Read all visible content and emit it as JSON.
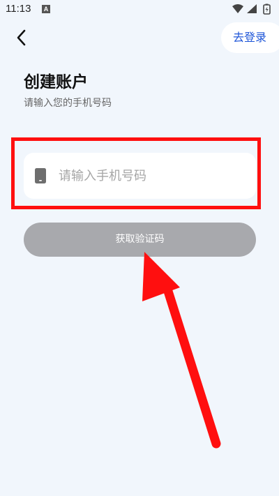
{
  "status_bar": {
    "time": "11:13",
    "notification_letter": "A",
    "icons": [
      "wifi-icon",
      "signal-icon",
      "battery-icon"
    ]
  },
  "header": {
    "back_icon": "chevron-left-icon",
    "login_label": "去登录"
  },
  "main": {
    "title": "创建账户",
    "subtitle": "请输入您的手机号码",
    "phone_input": {
      "value": "",
      "placeholder": "请输入手机号码",
      "icon": "phone-icon"
    },
    "get_code_label": "获取验证码"
  },
  "colors": {
    "background": "#f1f6fc",
    "accent": "#1e55d8",
    "button_disabled": "#a8a9ad",
    "annotation_red": "#ff0f0f"
  }
}
